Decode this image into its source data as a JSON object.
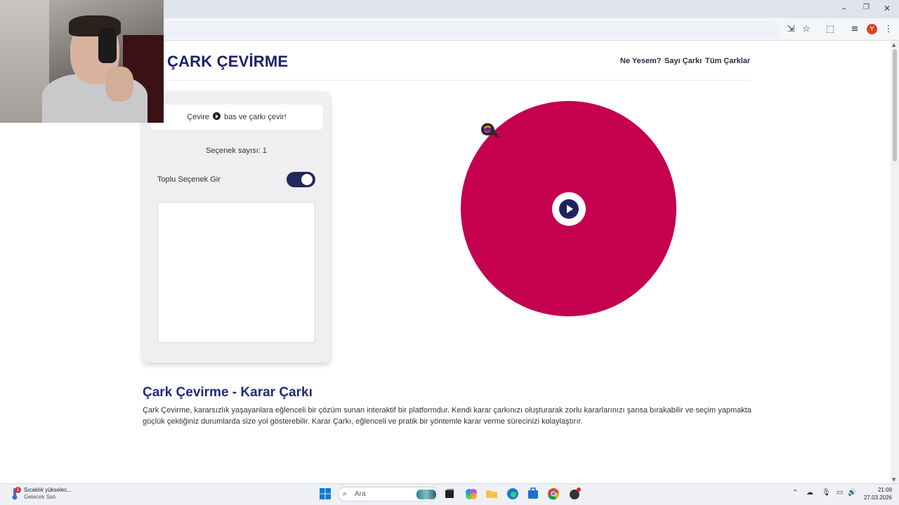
{
  "site": {
    "title": "ÇARK ÇEVİRME",
    "nav": [
      "Ne Yesem?",
      "Sayı Çarkı",
      "Tüm Çarklar"
    ]
  },
  "panel": {
    "hint_before": "Çevire",
    "hint_after": "bas ve çarkı çevir!",
    "option_count": "Seçenek sayısı: 1",
    "bulk_label": "Toplu Seçenek Gir",
    "bulk_enabled": true,
    "bulk_text": ""
  },
  "wheel": {
    "color": "#c4004f",
    "center_button_color": "#1f2260"
  },
  "article": {
    "title": "Çark Çevirme - Karar Çarkı",
    "text": "Çark Çevirme, kararsızlık yaşayanlara eğlenceli bir çözüm sunan interaktif bir platformdur. Kendi karar çarkınızı oluşturarak zorlu kararlarınızı şansa bırakabilir ve seçim yapmakta güçlük çektiğiniz durumlarda size yol gösterebilir. Karar Çarkı, eğlenceli ve pratik bir yöntemle karar verme sürecinizi kolaylaştırır."
  },
  "browser": {
    "profile_initial": "Y"
  },
  "taskbar": {
    "weather_title": "Sıcaklık yükselec...",
    "weather_sub": "Gelecek Salı",
    "weather_badge": "1",
    "search_placeholder": "Ara",
    "time": "21:09",
    "date": "27.03.2026"
  }
}
